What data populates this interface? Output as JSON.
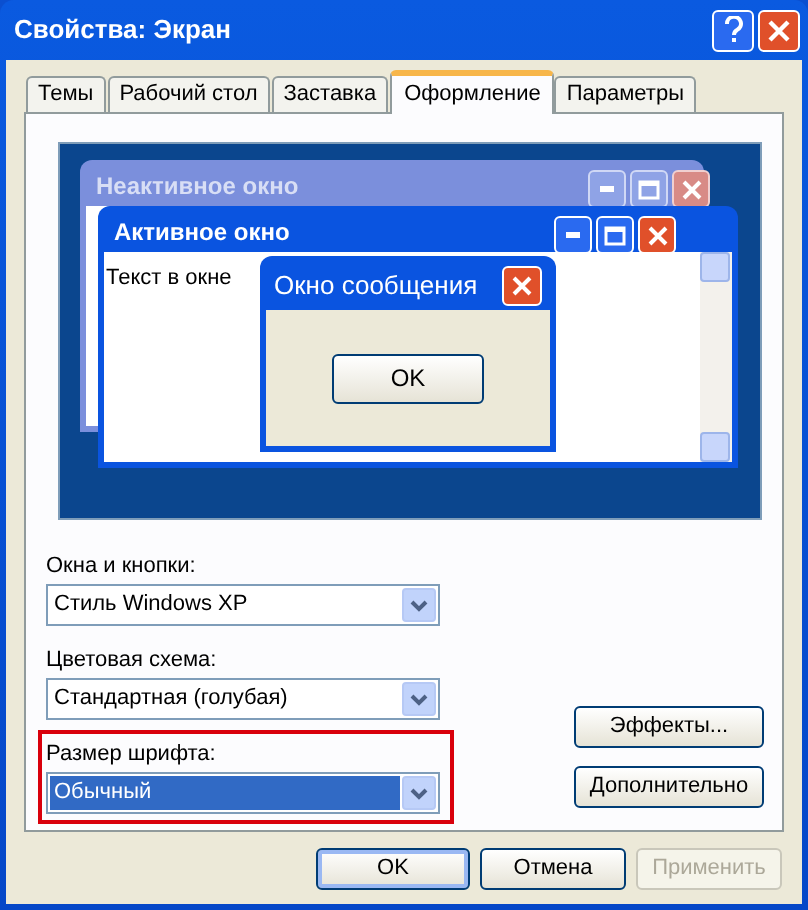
{
  "window": {
    "title": "Свойства: Экран"
  },
  "tabs": [
    {
      "label": "Темы",
      "selected": false
    },
    {
      "label": "Рабочий стол",
      "selected": false
    },
    {
      "label": "Заставка",
      "selected": false
    },
    {
      "label": "Оформление",
      "selected": true
    },
    {
      "label": "Параметры",
      "selected": false
    }
  ],
  "preview": {
    "inactive_window": {
      "title": "Неактивное окно"
    },
    "active_window": {
      "title": "Активное окно",
      "text": "Текст в окне"
    },
    "message_box": {
      "title": "Окно сообщения",
      "button": "OK"
    }
  },
  "fields": [
    {
      "label": "Окна и кнопки:",
      "value": "Стиль Windows XP",
      "selected": false,
      "highlighted": false
    },
    {
      "label": "Цветовая схема:",
      "value": "Стандартная (голубая)",
      "selected": false,
      "highlighted": false
    },
    {
      "label": "Размер шрифта:",
      "value": "Обычный",
      "selected": true,
      "highlighted": true
    }
  ],
  "side_buttons": [
    "Эффекты...",
    "Дополнительно"
  ],
  "buttons": [
    {
      "label": "OK",
      "default": true,
      "disabled": false
    },
    {
      "label": "Отмена",
      "default": false,
      "disabled": false
    },
    {
      "label": "Применить",
      "default": false,
      "disabled": true
    }
  ]
}
